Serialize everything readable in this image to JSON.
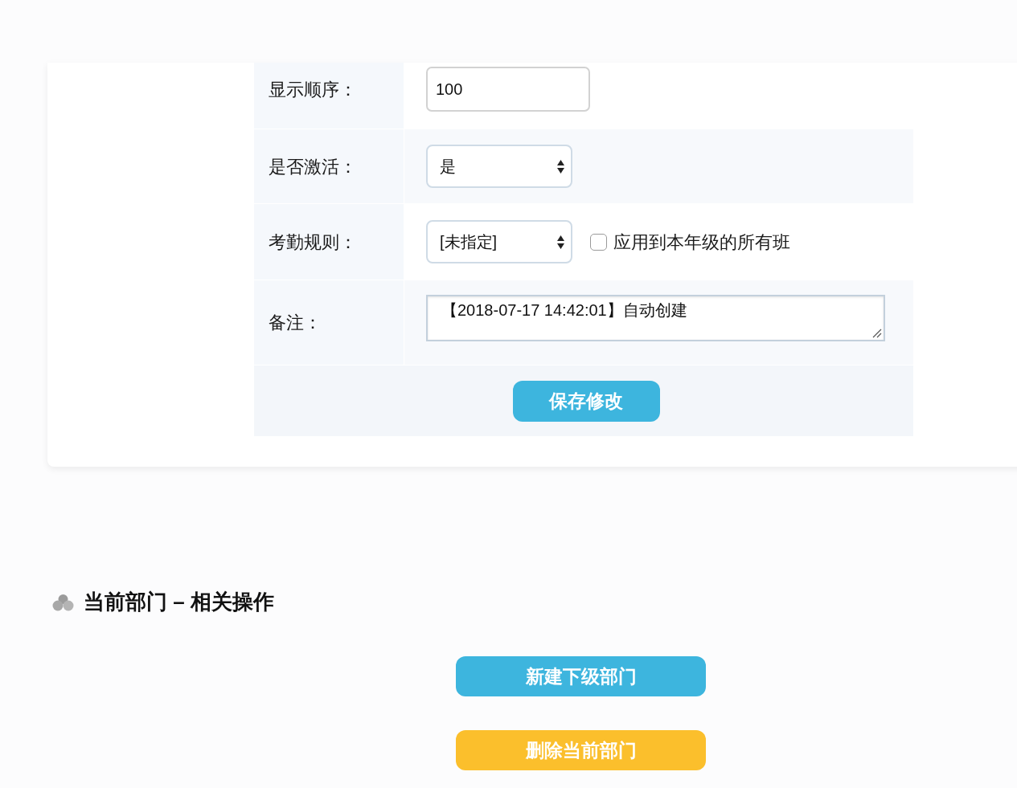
{
  "form": {
    "rows": [
      {
        "kind": "input",
        "label": "显示顺序：",
        "value": "100"
      },
      {
        "kind": "select",
        "label": "是否激活：",
        "value": "是"
      },
      {
        "kind": "select",
        "label": "考勤规则：",
        "value": "[未指定]",
        "checkbox": {
          "label": "应用到本年级的所有班",
          "checked": false
        }
      },
      {
        "kind": "textarea",
        "label": "备注：",
        "value": "【2018-07-17 14:42:01】自动创建"
      }
    ],
    "submit": "保存修改"
  },
  "section": {
    "title": "当前部门 – 相关操作",
    "actions": [
      {
        "kind": "primary",
        "label": "新建下级部门"
      },
      {
        "kind": "warning",
        "label": "删除当前部门"
      }
    ]
  }
}
